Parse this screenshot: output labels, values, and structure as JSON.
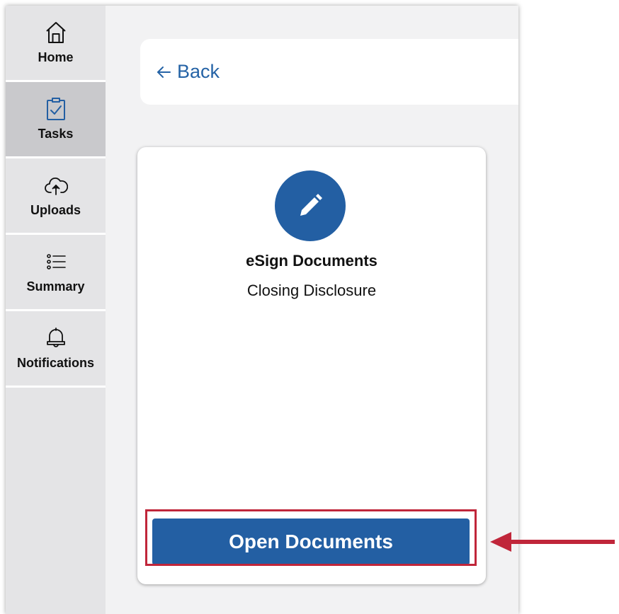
{
  "sidebar": {
    "items": [
      {
        "label": "Home",
        "icon": "home-icon",
        "active": false
      },
      {
        "label": "Tasks",
        "icon": "clipboard-check-icon",
        "active": true
      },
      {
        "label": "Uploads",
        "icon": "cloud-upload-icon",
        "active": false
      },
      {
        "label": "Summary",
        "icon": "list-icon",
        "active": false
      },
      {
        "label": "Notifications",
        "icon": "bell-icon",
        "active": false
      }
    ]
  },
  "header": {
    "back_label": "Back"
  },
  "card": {
    "icon": "pencil-icon",
    "title": "eSign Documents",
    "subtitle": "Closing Disclosure",
    "button_label": "Open Documents"
  },
  "colors": {
    "accent": "#235fa3",
    "link": "#2563a6",
    "highlight": "#c0263a",
    "sidebar_bg": "#e4e4e6",
    "sidebar_active": "#c9c9cc"
  }
}
